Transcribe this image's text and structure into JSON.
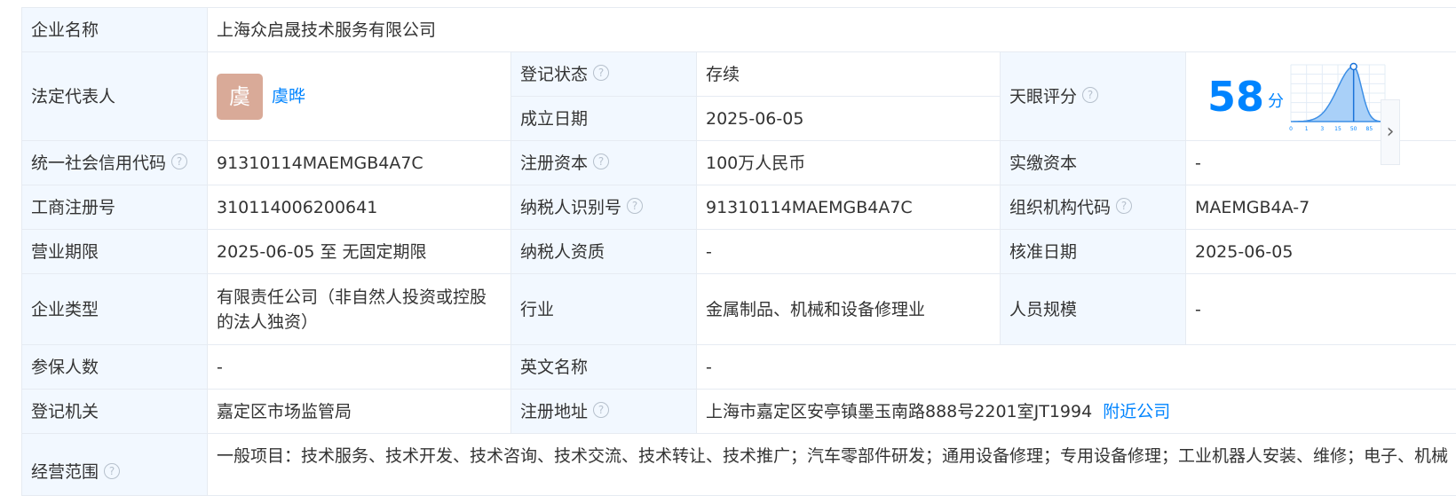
{
  "company": {
    "name_label": "企业名称",
    "name_value": "上海众启晟技术服务有限公司",
    "legal_rep_label": "法定代表人",
    "legal_rep_avatar": "虞",
    "legal_rep_name": "虞晔",
    "status_label": "登记状态",
    "status_value": "存续",
    "founded_label": "成立日期",
    "founded_value": "2025-06-05",
    "score_label": "天眼评分",
    "score_value": "58",
    "score_unit": "分",
    "credit_code_label": "统一社会信用代码",
    "credit_code_value": "91310114MAEMGB4A7C",
    "reg_capital_label": "注册资本",
    "reg_capital_value": "100万人民币",
    "paid_capital_label": "实缴资本",
    "paid_capital_value": "-",
    "biz_reg_no_label": "工商注册号",
    "biz_reg_no_value": "310114006200641",
    "taxpayer_id_label": "纳税人识别号",
    "taxpayer_id_value": "91310114MAEMGB4A7C",
    "org_code_label": "组织机构代码",
    "org_code_value": "MAEMGB4A-7",
    "term_label": "营业期限",
    "term_value": "2025-06-05 至 无固定期限",
    "tax_qual_label": "纳税人资质",
    "tax_qual_value": "-",
    "approval_date_label": "核准日期",
    "approval_date_value": "2025-06-05",
    "type_label": "企业类型",
    "type_value": "有限责任公司（非自然人投资或控股的法人独资）",
    "industry_label": "行业",
    "industry_value": "金属制品、机械和设备修理业",
    "staff_label": "人员规模",
    "staff_value": "-",
    "insured_label": "参保人数",
    "insured_value": "-",
    "en_name_label": "英文名称",
    "en_name_value": "-",
    "authority_label": "登记机关",
    "authority_value": "嘉定区市场监管局",
    "address_label": "注册地址",
    "address_value": "上海市嘉定区安亭镇墨玉南路888号2201室JT1994",
    "nearby_link": "附近公司",
    "scope_label": "经营范围",
    "scope_value": "一般项目：技术服务、技术开发、技术咨询、技术交流、技术转让、技术推广；汽车零部件研发；通用设备修理；专用设备修理；工业机器人安装、维修；电子、机械"
  },
  "score_chart": {
    "x_ticks": [
      "0",
      "1",
      "3",
      "15",
      "50",
      "85",
      "97"
    ],
    "highlight": 50,
    "accent": "#0084ff"
  },
  "help_glyph": "?",
  "next_glyph": "›"
}
